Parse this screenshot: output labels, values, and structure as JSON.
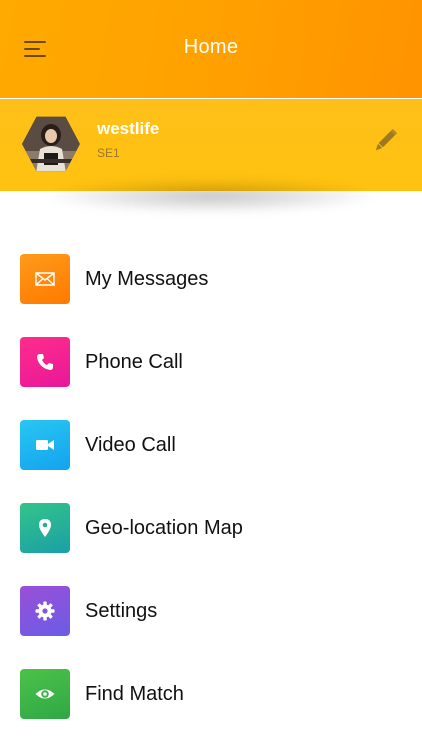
{
  "header": {
    "title": "Home",
    "menu_icon": "hamburger-menu-icon",
    "background_color": "#ffa000"
  },
  "profile": {
    "name": "westlife",
    "subtitle": "SE1",
    "avatar": "profile-avatar",
    "edit_icon": "pencil-icon",
    "background_color": "#ffc20f"
  },
  "menu": {
    "items": [
      {
        "label": "My Messages",
        "icon": "envelope-icon",
        "color_from": "#ff9a1a",
        "color_to": "#ff7a00"
      },
      {
        "label": "Phone Call",
        "icon": "phone-icon",
        "color_from": "#ff2d8a",
        "color_to": "#e8179a"
      },
      {
        "label": "Video Call",
        "icon": "video-camera-icon",
        "color_from": "#29c6f2",
        "color_to": "#13a3ef"
      },
      {
        "label": "Geo-location Map",
        "icon": "map-pin-icon",
        "color_from": "#34c48a",
        "color_to": "#1a9fa6"
      },
      {
        "label": "Settings",
        "icon": "gear-icon",
        "color_from": "#9a4fd8",
        "color_to": "#6b5ce6"
      },
      {
        "label": "Find Match",
        "icon": "eye-icon",
        "color_from": "#4cc24a",
        "color_to": "#2fa844"
      }
    ]
  }
}
